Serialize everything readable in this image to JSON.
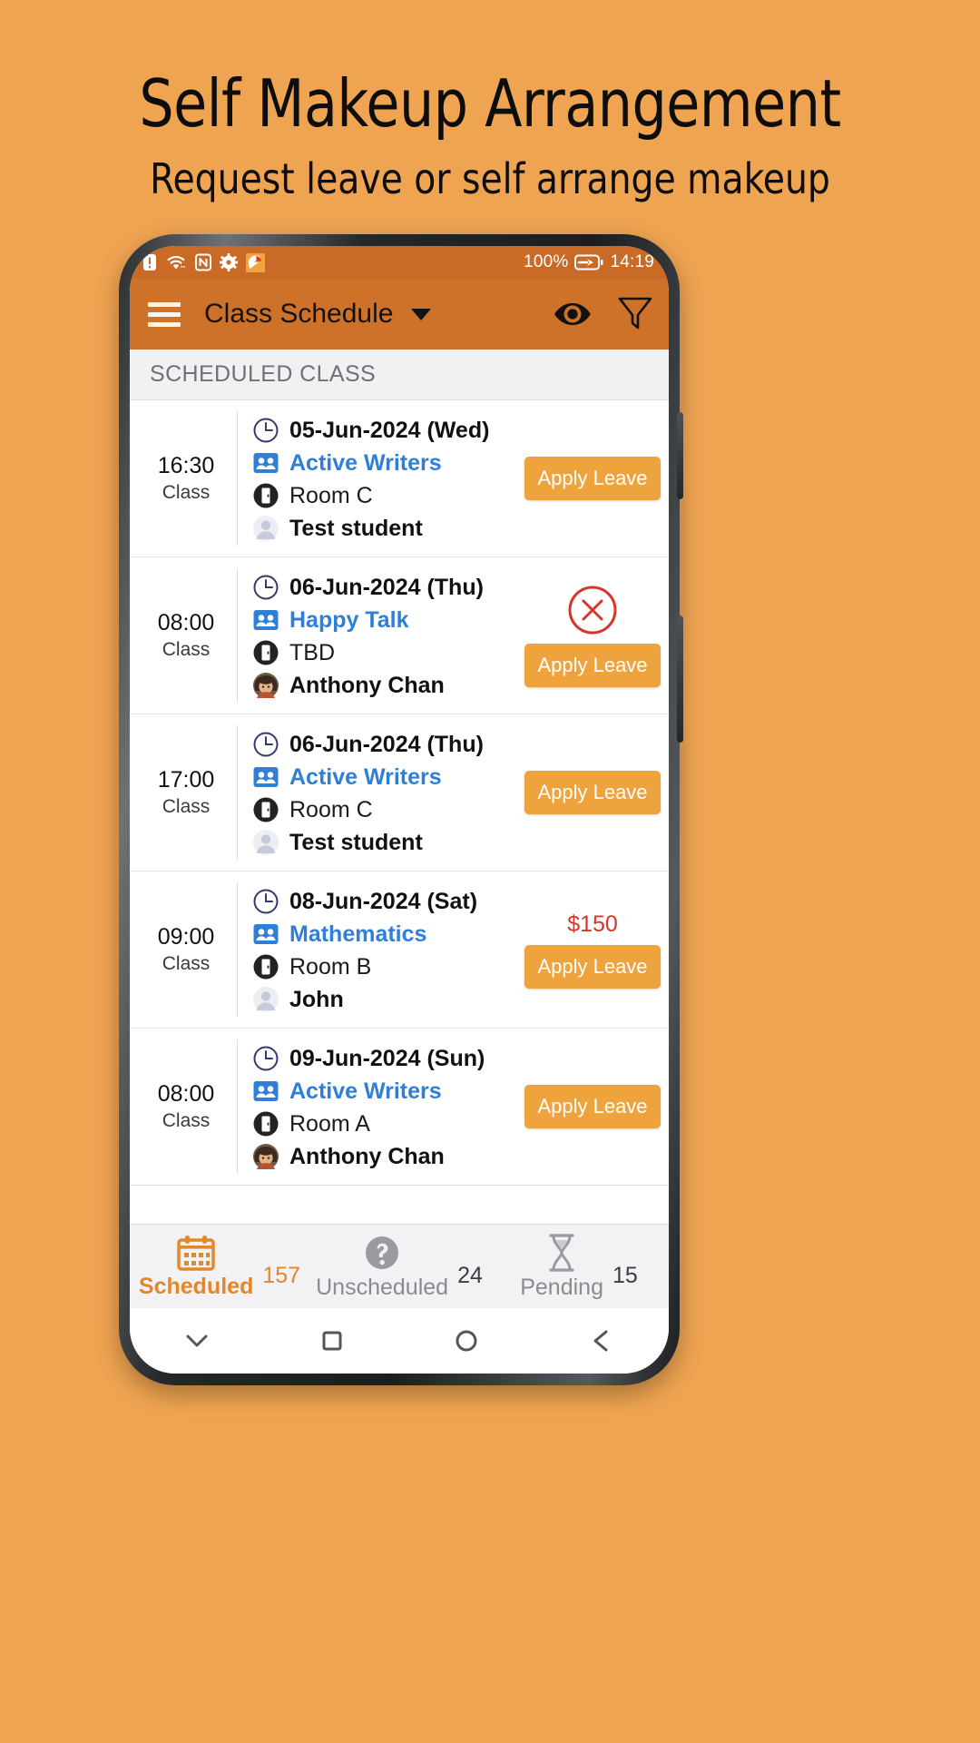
{
  "promo": {
    "title": "Self Makeup Arrangement",
    "subtitle": "Request leave or self arrange makeup",
    "background_color": "#efa451"
  },
  "statusbar": {
    "icons": [
      "sim-alert-icon",
      "wifi-icon",
      "nfc-icon",
      "gear-icon",
      "app-badge-icon"
    ],
    "battery_percent": "100%",
    "battery_icon": "battery-charging-icon",
    "time": "14:19"
  },
  "appbar": {
    "menu_icon": "hamburger-menu-icon",
    "title": "Class Schedule",
    "dropdown_icon": "chevron-down-icon",
    "eye_icon": "eye-icon",
    "filter_icon": "filter-funnel-icon",
    "background_color": "#cf7229"
  },
  "section": {
    "header": "SCHEDULED CLASS"
  },
  "rows": [
    {
      "time": "16:30",
      "time_label": "Class",
      "date": "05-Jun-2024 (Wed)",
      "class_name": "Active Writers",
      "room": "Room C",
      "student": "Test student",
      "student_avatar": "generic-avatar",
      "action_label": "Apply Leave",
      "price": null,
      "has_cancel": false
    },
    {
      "time": "08:00",
      "time_label": "Class",
      "date": "06-Jun-2024 (Thu)",
      "class_name": "Happy Talk",
      "room": "TBD",
      "student": "Anthony Chan",
      "student_avatar": "photo-avatar",
      "action_label": "Apply Leave",
      "price": null,
      "has_cancel": true
    },
    {
      "time": "17:00",
      "time_label": "Class",
      "date": "06-Jun-2024 (Thu)",
      "class_name": "Active Writers",
      "room": "Room C",
      "student": "Test student",
      "student_avatar": "generic-avatar",
      "action_label": "Apply Leave",
      "price": null,
      "has_cancel": false
    },
    {
      "time": "09:00",
      "time_label": "Class",
      "date": "08-Jun-2024 (Sat)",
      "class_name": "Mathematics",
      "room": "Room B",
      "student": "John",
      "student_avatar": "generic-avatar",
      "action_label": "Apply Leave",
      "price": "$150",
      "has_cancel": false
    },
    {
      "time": "08:00",
      "time_label": "Class",
      "date": "09-Jun-2024 (Sun)",
      "class_name": "Active Writers",
      "room": "Room A",
      "student": "Anthony Chan",
      "student_avatar": "photo-avatar",
      "action_label": "Apply Leave",
      "price": null,
      "has_cancel": false
    }
  ],
  "tabs": [
    {
      "label": "Scheduled",
      "count": "157",
      "icon": "calendar-icon",
      "active": true
    },
    {
      "label": "Unscheduled",
      "count": "24",
      "icon": "question-mark-icon",
      "active": false
    },
    {
      "label": "Pending",
      "count": "15",
      "icon": "hourglass-icon",
      "active": false
    }
  ],
  "navbar": {
    "collapse_icon": "chevron-down-icon",
    "recents_icon": "square-icon",
    "home_icon": "circle-icon",
    "back_icon": "triangle-back-icon"
  },
  "colors": {
    "accent_orange": "#efa33c",
    "appbar_orange": "#cf7229",
    "class_blue": "#2f7fd6",
    "price_red": "#d8352a",
    "tab_active": "#e2872a"
  }
}
